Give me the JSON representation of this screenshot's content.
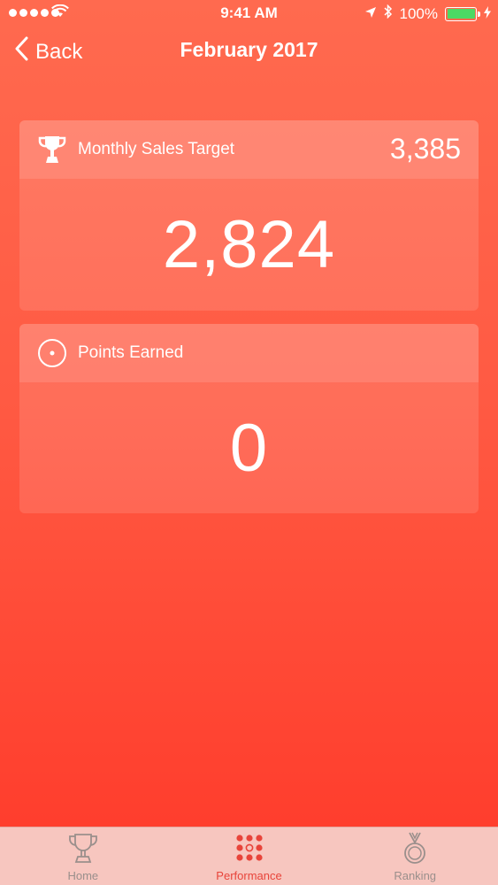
{
  "status_bar": {
    "time": "9:41 AM",
    "battery_percent": "100%",
    "icons": [
      "signal-dots",
      "wifi",
      "location-arrow",
      "bluetooth",
      "battery",
      "charging-bolt"
    ],
    "battery_level": 1.0,
    "battery_color": "#4cd964"
  },
  "nav": {
    "back_label": "Back",
    "title": "February 2017"
  },
  "cards": {
    "sales": {
      "icon": "trophy-icon",
      "label": "Monthly Sales Target",
      "target": "3,385",
      "value": "2,824"
    },
    "points": {
      "icon": "target-circle-icon",
      "label": "Points Earned",
      "value": "0"
    }
  },
  "tabs": [
    {
      "label": "Home",
      "icon": "trophy-outline-icon",
      "active": false
    },
    {
      "label": "Performance",
      "icon": "dot-grid-icon",
      "active": true
    },
    {
      "label": "Ranking",
      "icon": "medal-icon",
      "active": false
    }
  ],
  "colors": {
    "background_top": "#ff6a4f",
    "background_bottom": "#ff3a2a",
    "tab_active": "#e8443a",
    "tab_inactive": "#9a8f8c",
    "tab_bar_bg": "#f7c6bf"
  }
}
